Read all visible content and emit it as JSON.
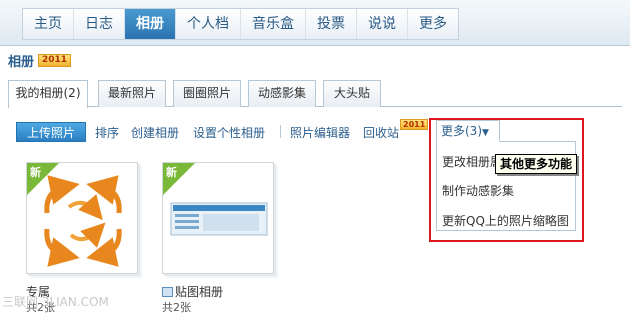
{
  "nav": {
    "items": [
      "主页",
      "日志",
      "相册",
      "个人档",
      "音乐盒",
      "投票",
      "说说",
      "更多"
    ],
    "active_index": 2
  },
  "album_header": {
    "title": "相册",
    "badge": "2011"
  },
  "tabs": [
    "我的相册(2)",
    "最新照片",
    "圈圈照片",
    "动感影集",
    "大头贴"
  ],
  "toolbar": {
    "upload": "上传照片",
    "sort": "排序",
    "create": "创建相册",
    "personalize": "设置个性相册",
    "editor": "照片编辑器",
    "recycle": "回收站",
    "recycle_badge": "2011"
  },
  "more_menu": {
    "trigger": "更多(3)",
    "items": [
      "更改相册属性",
      "制作动感影集",
      "更新QQ上的照片缩略图"
    ],
    "tooltip": "其他更多功能"
  },
  "albums": [
    {
      "name": "专属",
      "count": "共2张",
      "flag": "新"
    },
    {
      "name": "贴图相册",
      "count": "共2张",
      "flag": "新"
    }
  ],
  "watermark": "三联网 3LIAN.COM",
  "colors": {
    "accent": "#2b73b0",
    "highlight": "#e0141e",
    "new_flag": "#7ab83a"
  }
}
